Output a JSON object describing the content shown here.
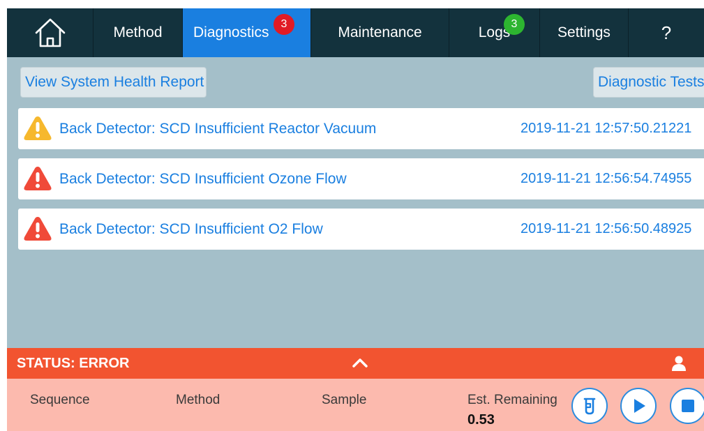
{
  "nav": {
    "home_icon": "home-icon",
    "items": [
      {
        "label": "Method"
      },
      {
        "label": "Diagnostics",
        "badge": "3",
        "badge_color": "#e11b24"
      },
      {
        "label": "Maintenance"
      },
      {
        "label": "Logs",
        "badge": "3",
        "badge_color": "#2db530"
      },
      {
        "label": "Settings"
      },
      {
        "label": "?"
      }
    ]
  },
  "toolbar": {
    "health_report_label": "View System Health Report",
    "diagnostic_tests_label": "Diagnostic Tests"
  },
  "alerts": [
    {
      "severity": "warning",
      "icon": "warning-icon",
      "color": "#f6b82d",
      "message": "Back Detector: SCD Insufficient Reactor Vacuum",
      "timestamp": "2019-11-21  12:57:50.21221"
    },
    {
      "severity": "error",
      "icon": "error-icon",
      "color": "#f04a39",
      "message": "Back Detector: SCD Insufficient Ozone Flow",
      "timestamp": "2019-11-21  12:56:54.74955"
    },
    {
      "severity": "error",
      "icon": "error-icon",
      "color": "#f04a39",
      "message": "Back Detector: SCD Insufficient O2 Flow",
      "timestamp": "2019-11-21  12:56:50.48925"
    }
  ],
  "status": {
    "text": "STATUS: ERROR",
    "color": "#f25430"
  },
  "bottom": {
    "sequence_label": "Sequence",
    "method_label": "Method",
    "sample_label": "Sample",
    "remaining_label": "Est. Remaining",
    "remaining_value": "0.53",
    "buttons": [
      "vial-icon",
      "play-icon",
      "stop-icon"
    ]
  },
  "colors": {
    "accent": "#1a7fe0",
    "nav_bg": "#13323d",
    "content_bg": "#a4bfc9",
    "bottom_bg": "#fcbaae"
  }
}
